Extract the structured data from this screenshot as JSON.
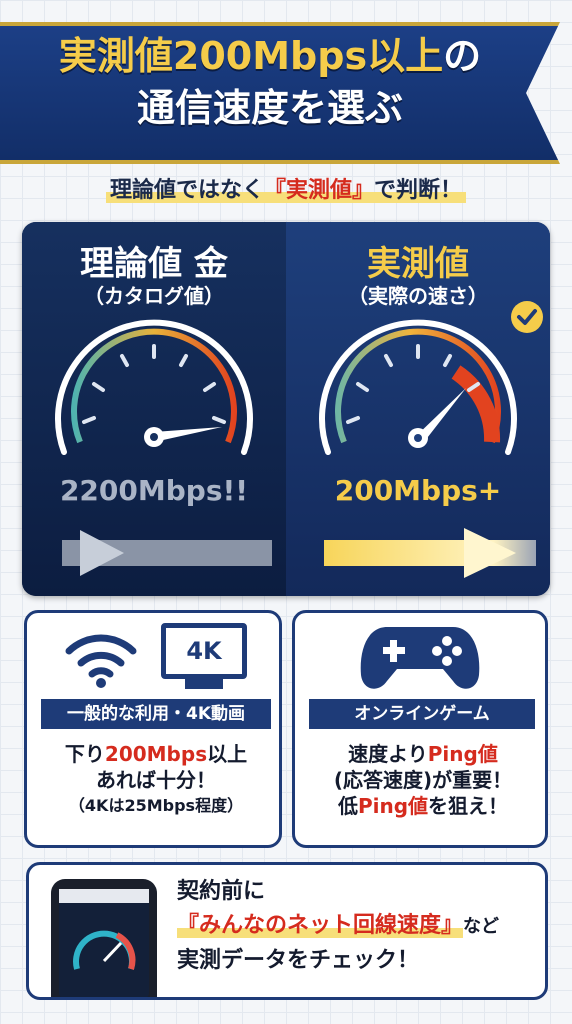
{
  "header": {
    "line1_highlight": "実測値200Mbps以上",
    "line1_suffix": "の",
    "line2": "通信速度を選ぶ"
  },
  "subtitle": {
    "prefix": "理論値ではなく",
    "highlight": "『実測値』",
    "suffix": "で判断！"
  },
  "comparison": {
    "left": {
      "title": "理論値 金",
      "subtitle": "（カタログ値）",
      "speed": "2200Mbps!!",
      "gauge_level": 0.85
    },
    "right": {
      "title": "実測値",
      "subtitle": "（実際の速さ）",
      "speed": "200Mbps+",
      "gauge_level": 0.7,
      "check_icon": "check-circle-icon"
    }
  },
  "cards": {
    "general": {
      "icons": [
        "wifi-icon",
        "4k-tv-icon"
      ],
      "tv_label": "4K",
      "label": "一般的な利用・4K動画",
      "line1_prefix": "下り",
      "line1_highlight": "200Mbps",
      "line1_suffix": "以上",
      "line2": "あれば十分！",
      "note": "（4Kは25Mbps程度）"
    },
    "gaming": {
      "icons": [
        "gamepad-icon"
      ],
      "label": "オンラインゲーム",
      "line1_prefix": "速度より",
      "line1_highlight": "Ping値",
      "line2": "(応答速度)が重要！",
      "line3_prefix": "低",
      "line3_highlight": "Ping値",
      "line3_suffix": "を狙え！"
    },
    "check": {
      "phone_icon": "smartphone-speedtest-icon",
      "line1": "契約前に",
      "line2_highlight": "『みんなのネット回線速度』",
      "line2_suffix": "など",
      "line3": "実測データをチェック！"
    }
  },
  "colors": {
    "navy": "#1e3b78",
    "gold": "#f5cc4a",
    "red": "#d52b1e"
  }
}
